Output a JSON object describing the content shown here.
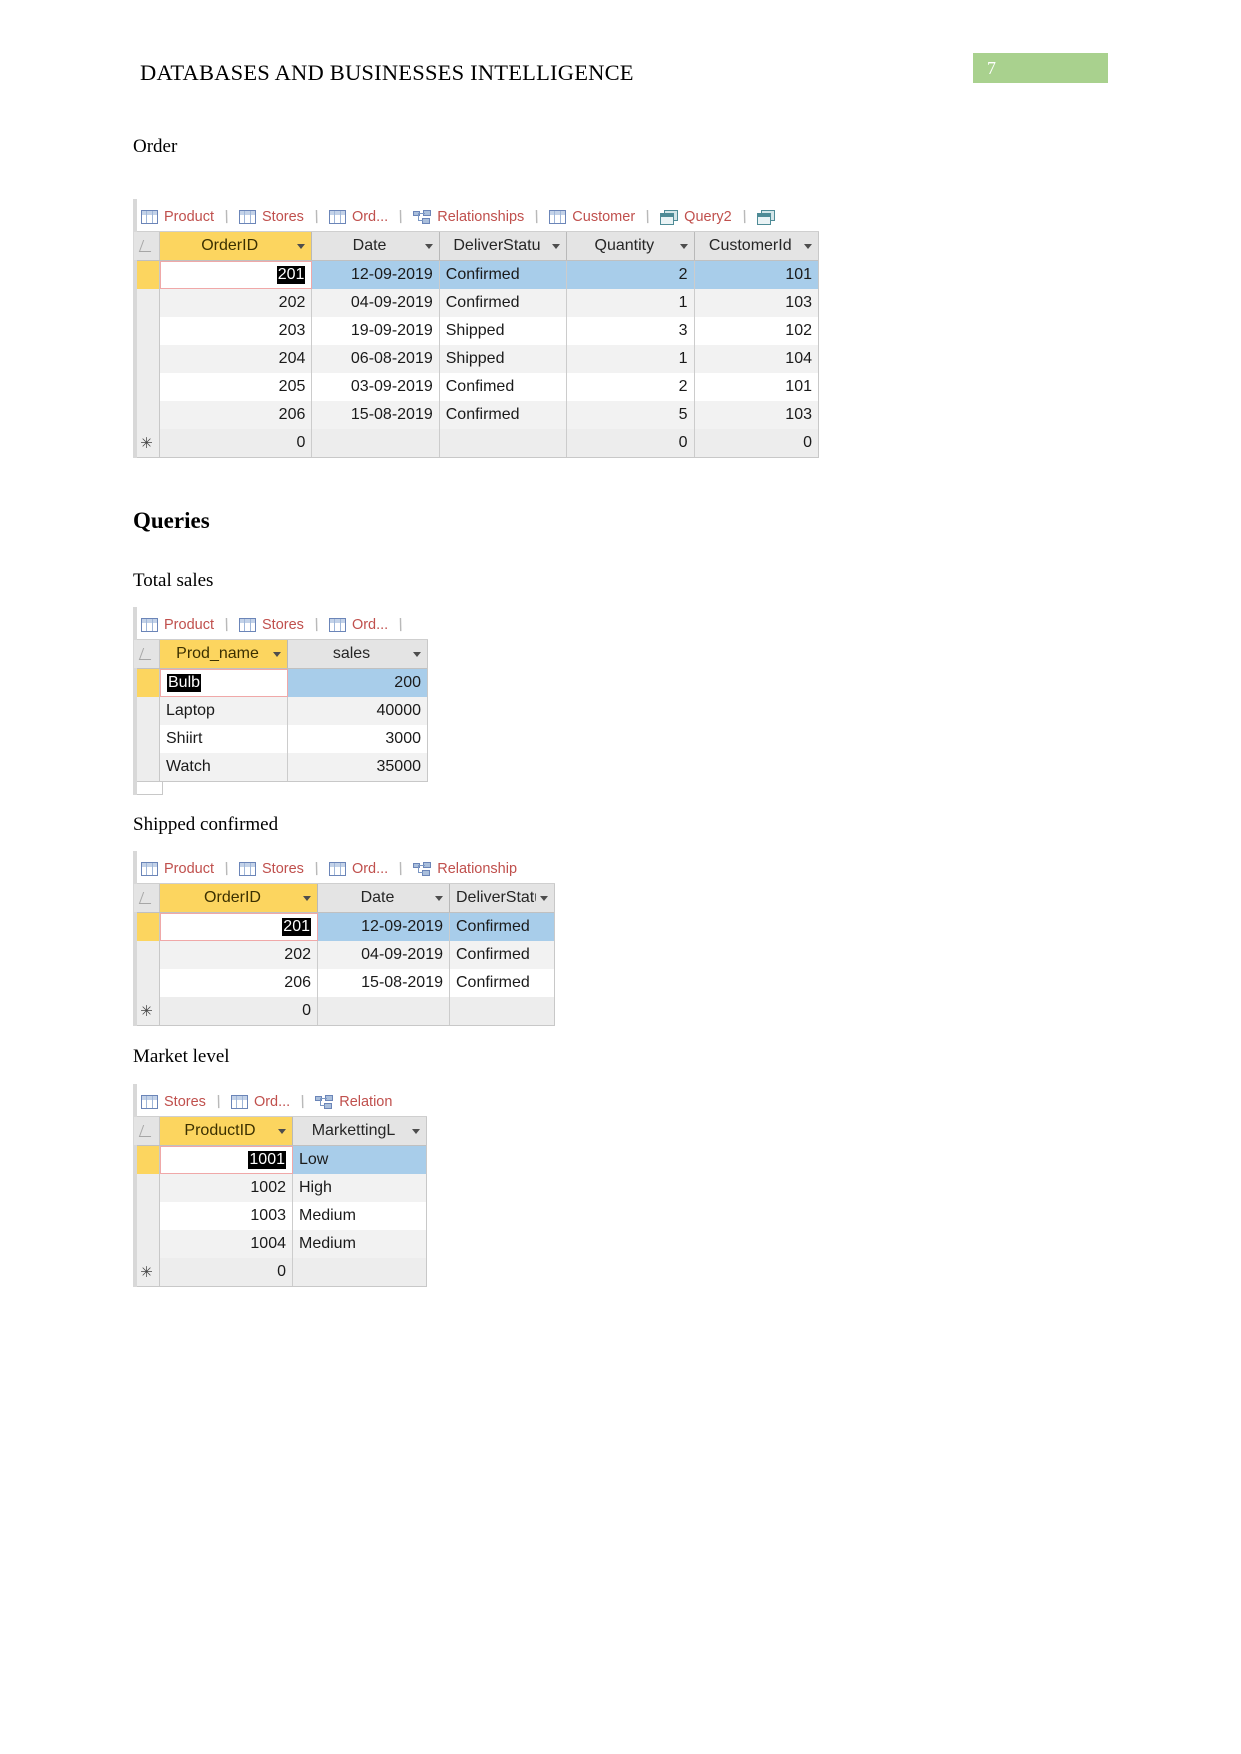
{
  "header": {
    "title": "DATABASES AND BUSINESSES INTELLIGENCE",
    "page_number": "7",
    "badge_color": "#a9d18e"
  },
  "labels": {
    "order": "Order",
    "queries": "Queries",
    "total_sales": "Total sales",
    "shipped_confirmed": "Shipped confirmed",
    "market_level": "Market level"
  },
  "order_table": {
    "tabs": [
      {
        "label": "Product",
        "icon": "table-icon"
      },
      {
        "label": "Stores",
        "icon": "table-icon"
      },
      {
        "label": "Ord...",
        "icon": "table-icon"
      },
      {
        "label": "Relationships",
        "icon": "relationships-icon"
      },
      {
        "label": "Customer",
        "icon": "table-icon"
      },
      {
        "label": "Query2",
        "icon": "query-icon"
      }
    ],
    "columns": [
      "OrderID",
      "Date",
      "DeliverStatu",
      "Quantity",
      "CustomerId"
    ],
    "rows": [
      {
        "OrderID": "201",
        "Date": "12-09-2019",
        "DeliverStatu": "Confirmed",
        "Quantity": "2",
        "CustomerId": "101"
      },
      {
        "OrderID": "202",
        "Date": "04-09-2019",
        "DeliverStatu": "Confirmed",
        "Quantity": "1",
        "CustomerId": "103"
      },
      {
        "OrderID": "203",
        "Date": "19-09-2019",
        "DeliverStatu": "Shipped",
        "Quantity": "3",
        "CustomerId": "102"
      },
      {
        "OrderID": "204",
        "Date": "06-08-2019",
        "DeliverStatu": "Shipped",
        "Quantity": "1",
        "CustomerId": "104"
      },
      {
        "OrderID": "205",
        "Date": "03-09-2019",
        "DeliverStatu": "Confimed",
        "Quantity": "2",
        "CustomerId": "101"
      },
      {
        "OrderID": "206",
        "Date": "15-08-2019",
        "DeliverStatu": "Confirmed",
        "Quantity": "5",
        "CustomerId": "103"
      }
    ],
    "new_row": {
      "OrderID": "0",
      "Date": "",
      "DeliverStatu": "",
      "Quantity": "0",
      "CustomerId": "0",
      "marker": "✳"
    },
    "selected_cell_value": "201"
  },
  "total_sales_table": {
    "tabs": [
      {
        "label": "Product",
        "icon": "table-icon"
      },
      {
        "label": "Stores",
        "icon": "table-icon"
      },
      {
        "label": "Ord...",
        "icon": "table-icon"
      }
    ],
    "columns": [
      "Prod_name",
      "sales"
    ],
    "rows": [
      {
        "Prod_name": "Bulb",
        "sales": "200"
      },
      {
        "Prod_name": "Laptop",
        "sales": "40000"
      },
      {
        "Prod_name": "Shiirt",
        "sales": "3000"
      },
      {
        "Prod_name": "Watch",
        "sales": "35000"
      }
    ],
    "selected_cell_value": "Bulb"
  },
  "shipped_confirmed_table": {
    "tabs": [
      {
        "label": "Product",
        "icon": "table-icon"
      },
      {
        "label": "Stores",
        "icon": "table-icon"
      },
      {
        "label": "Ord...",
        "icon": "table-icon"
      },
      {
        "label": "Relationship",
        "icon": "relationships-icon"
      }
    ],
    "columns": [
      "OrderID",
      "Date",
      "DeliverStatu"
    ],
    "rows": [
      {
        "OrderID": "201",
        "Date": "12-09-2019",
        "DeliverStatu": "Confirmed"
      },
      {
        "OrderID": "202",
        "Date": "04-09-2019",
        "DeliverStatu": "Confirmed"
      },
      {
        "OrderID": "206",
        "Date": "15-08-2019",
        "DeliverStatu": "Confirmed"
      }
    ],
    "new_row": {
      "OrderID": "0",
      "Date": "",
      "DeliverStatu": "",
      "marker": "✳"
    },
    "selected_cell_value": "201"
  },
  "market_level_table": {
    "tabs": [
      {
        "label": "Stores",
        "icon": "table-icon"
      },
      {
        "label": "Ord...",
        "icon": "table-icon"
      },
      {
        "label": "Relation",
        "icon": "relationships-icon"
      }
    ],
    "columns": [
      "ProductID",
      "MarkettingL"
    ],
    "rows": [
      {
        "ProductID": "1001",
        "MarkettingL": "Low"
      },
      {
        "ProductID": "1002",
        "MarkettingL": "High"
      },
      {
        "ProductID": "1003",
        "MarkettingL": "Medium"
      },
      {
        "ProductID": "1004",
        "MarkettingL": "Medium"
      }
    ],
    "new_row": {
      "ProductID": "0",
      "MarkettingL": "",
      "marker": "✳"
    },
    "selected_cell_value": "1001"
  }
}
